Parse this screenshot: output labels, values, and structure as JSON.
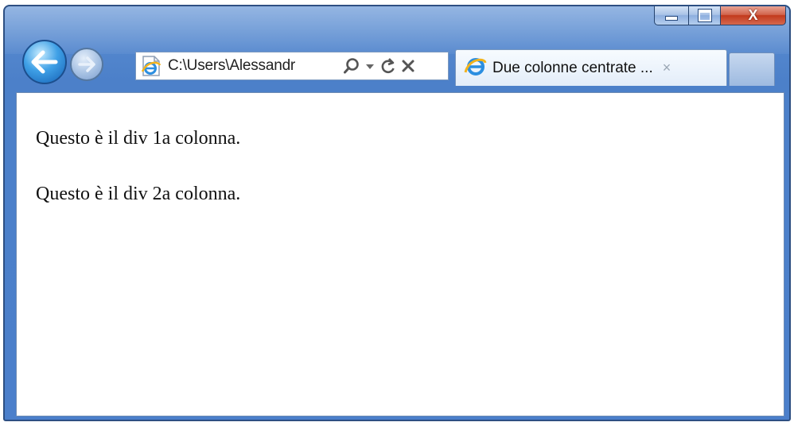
{
  "window": {
    "caption_buttons": {
      "minimize_icon": "minimize-icon",
      "maximize_icon": "maximize-icon",
      "close_icon": "close-icon",
      "close_glyph": "X"
    }
  },
  "navigation": {
    "back_icon": "arrow-left-icon",
    "forward_icon": "arrow-right-icon"
  },
  "address_bar": {
    "value": "C:\\Users\\Alessandr",
    "page_icon": "ie-page-icon",
    "tools": [
      "search-icon",
      "dropdown-icon",
      "refresh-icon",
      "stop-icon"
    ]
  },
  "tabs": [
    {
      "title": "Due colonne centrate ...",
      "icon": "ie-logo-icon",
      "close": "×"
    }
  ],
  "page": {
    "paragraphs": [
      "Questo è il div 1a colonna.",
      "Questo è il div 2a colonna."
    ]
  },
  "colors": {
    "frame": "#4b7fcb",
    "close_button": "#c2391c",
    "back_button": "#2a85d4"
  }
}
